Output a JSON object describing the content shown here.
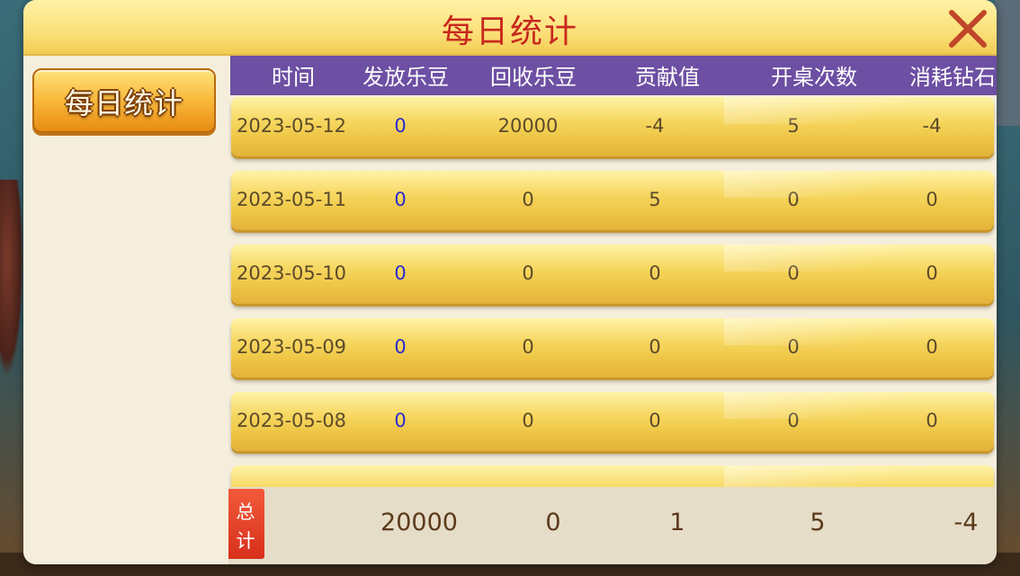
{
  "window": {
    "title": "每日统计",
    "close_label": "✕"
  },
  "sidebar": {
    "tabs": [
      {
        "label": "每日统计",
        "active": true
      }
    ]
  },
  "table": {
    "columns": [
      "时间",
      "发放乐豆",
      "回收乐豆",
      "贡献值",
      "开桌次数",
      "消耗钻石"
    ],
    "rows": [
      {
        "date": "2023-05-12",
        "issued": "0",
        "recovered": "20000",
        "contribution": "-4",
        "tables_opened": "5",
        "diamonds_used": "-4"
      },
      {
        "date": "2023-05-11",
        "issued": "0",
        "recovered": "0",
        "contribution": "5",
        "tables_opened": "0",
        "diamonds_used": "0"
      },
      {
        "date": "2023-05-10",
        "issued": "0",
        "recovered": "0",
        "contribution": "0",
        "tables_opened": "0",
        "diamonds_used": "0"
      },
      {
        "date": "2023-05-09",
        "issued": "0",
        "recovered": "0",
        "contribution": "0",
        "tables_opened": "0",
        "diamonds_used": "0"
      },
      {
        "date": "2023-05-08",
        "issued": "0",
        "recovered": "0",
        "contribution": "0",
        "tables_opened": "0",
        "diamonds_used": "0"
      }
    ]
  },
  "total": {
    "tag_line1": "总",
    "tag_line2": "计",
    "issued": "20000",
    "recovered": "0",
    "contribution": "1",
    "tables_opened": "5",
    "diamonds_used": "-4"
  },
  "colors": {
    "title_red": "#c8281e",
    "header_purple": "#6d4fa3",
    "issued_blue": "#2a2ad0",
    "row_gold": "#f6d760",
    "total_tag_red": "#d8301c"
  }
}
